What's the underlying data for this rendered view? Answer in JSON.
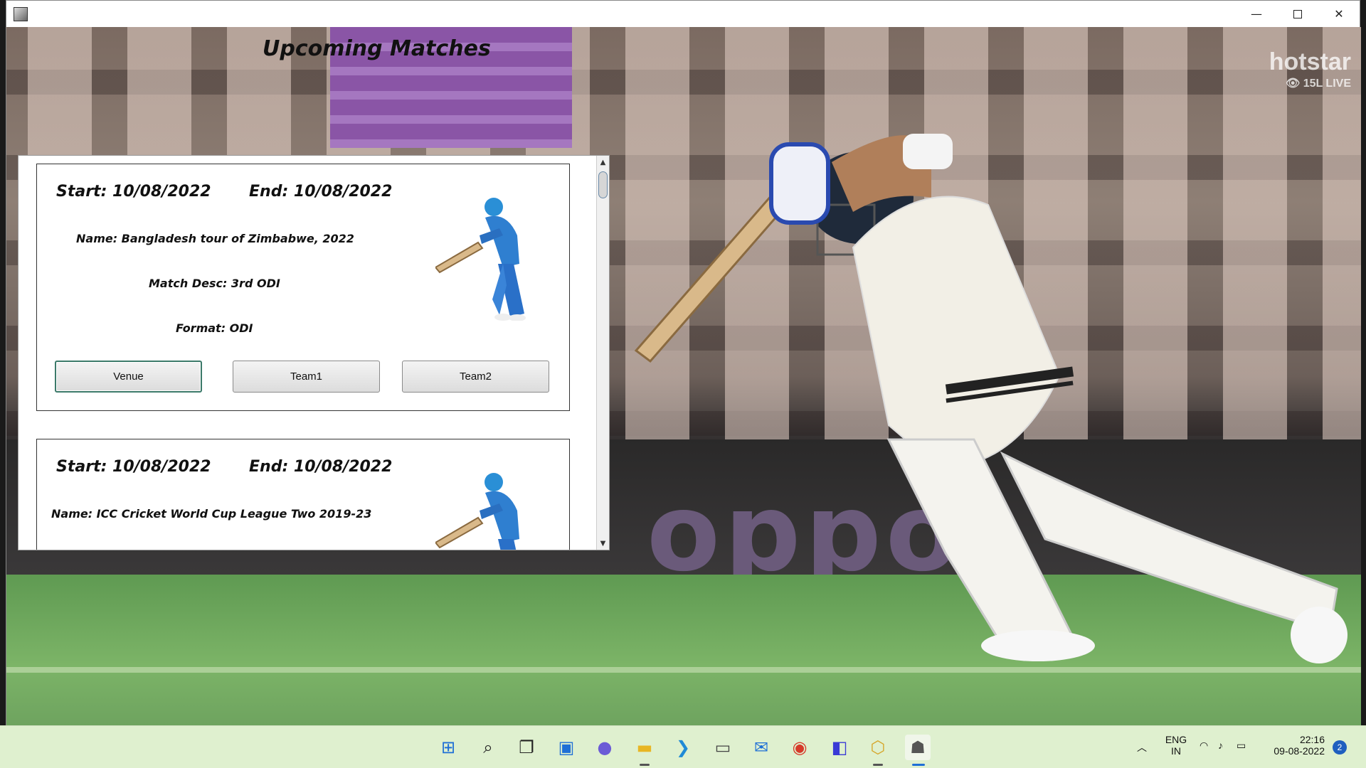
{
  "window": {
    "title_icon": "java-app-icon",
    "controls": {
      "minimize": "—",
      "close": "✕"
    }
  },
  "overlay": {
    "brand": "hotstar",
    "live_count": "15L LIVE"
  },
  "heading": "Upcoming Matches",
  "matches": [
    {
      "start": "Start: 10/08/2022",
      "end": "End: 10/08/2022",
      "name": "Name: Bangladesh tour of Zimbabwe, 2022",
      "desc": "Match Desc: 3rd ODI",
      "format": "Format: ODI",
      "buttons": {
        "venue": "Venue",
        "team1": "Team1",
        "team2": "Team2"
      }
    },
    {
      "start": "Start: 10/08/2022",
      "end": "End: 10/08/2022",
      "name": "Name: ICC Cricket World Cup League Two 2019-23"
    }
  ],
  "background": {
    "sponsor": "oppo"
  },
  "taskbar": {
    "apps": [
      "windows-start-icon",
      "search-icon",
      "task-view-icon",
      "widgets-icon",
      "chat-icon",
      "file-explorer-icon",
      "vscode-icon",
      "terminal-icon",
      "mail-icon",
      "chrome-icon",
      "editor-icon",
      "app-icon",
      "java-app-icon"
    ],
    "lang_top": "ENG",
    "lang_bottom": "IN",
    "time": "22:16",
    "date": "09-08-2022",
    "notifications": "2"
  }
}
